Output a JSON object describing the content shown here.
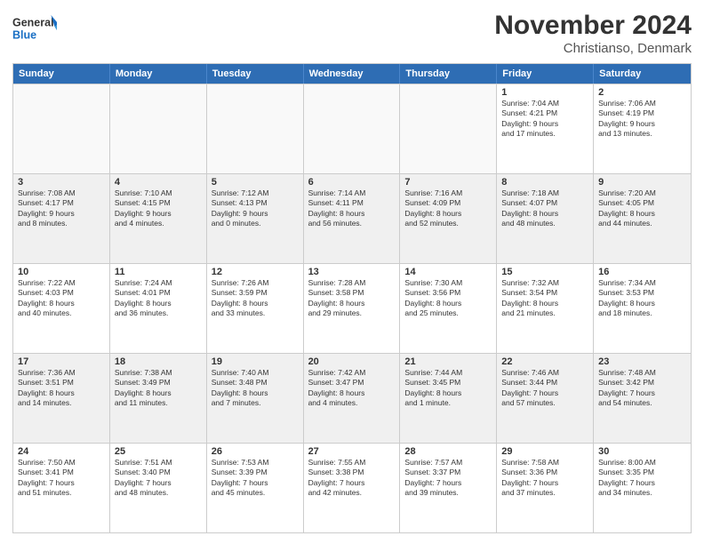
{
  "logo": {
    "text_general": "General",
    "text_blue": "Blue"
  },
  "header": {
    "title": "November 2024",
    "subtitle": "Christianso, Denmark"
  },
  "weekdays": [
    "Sunday",
    "Monday",
    "Tuesday",
    "Wednesday",
    "Thursday",
    "Friday",
    "Saturday"
  ],
  "weeks": [
    [
      {
        "day": "",
        "info": ""
      },
      {
        "day": "",
        "info": ""
      },
      {
        "day": "",
        "info": ""
      },
      {
        "day": "",
        "info": ""
      },
      {
        "day": "",
        "info": ""
      },
      {
        "day": "1",
        "info": "Sunrise: 7:04 AM\nSunset: 4:21 PM\nDaylight: 9 hours\nand 17 minutes."
      },
      {
        "day": "2",
        "info": "Sunrise: 7:06 AM\nSunset: 4:19 PM\nDaylight: 9 hours\nand 13 minutes."
      }
    ],
    [
      {
        "day": "3",
        "info": "Sunrise: 7:08 AM\nSunset: 4:17 PM\nDaylight: 9 hours\nand 8 minutes."
      },
      {
        "day": "4",
        "info": "Sunrise: 7:10 AM\nSunset: 4:15 PM\nDaylight: 9 hours\nand 4 minutes."
      },
      {
        "day": "5",
        "info": "Sunrise: 7:12 AM\nSunset: 4:13 PM\nDaylight: 9 hours\nand 0 minutes."
      },
      {
        "day": "6",
        "info": "Sunrise: 7:14 AM\nSunset: 4:11 PM\nDaylight: 8 hours\nand 56 minutes."
      },
      {
        "day": "7",
        "info": "Sunrise: 7:16 AM\nSunset: 4:09 PM\nDaylight: 8 hours\nand 52 minutes."
      },
      {
        "day": "8",
        "info": "Sunrise: 7:18 AM\nSunset: 4:07 PM\nDaylight: 8 hours\nand 48 minutes."
      },
      {
        "day": "9",
        "info": "Sunrise: 7:20 AM\nSunset: 4:05 PM\nDaylight: 8 hours\nand 44 minutes."
      }
    ],
    [
      {
        "day": "10",
        "info": "Sunrise: 7:22 AM\nSunset: 4:03 PM\nDaylight: 8 hours\nand 40 minutes."
      },
      {
        "day": "11",
        "info": "Sunrise: 7:24 AM\nSunset: 4:01 PM\nDaylight: 8 hours\nand 36 minutes."
      },
      {
        "day": "12",
        "info": "Sunrise: 7:26 AM\nSunset: 3:59 PM\nDaylight: 8 hours\nand 33 minutes."
      },
      {
        "day": "13",
        "info": "Sunrise: 7:28 AM\nSunset: 3:58 PM\nDaylight: 8 hours\nand 29 minutes."
      },
      {
        "day": "14",
        "info": "Sunrise: 7:30 AM\nSunset: 3:56 PM\nDaylight: 8 hours\nand 25 minutes."
      },
      {
        "day": "15",
        "info": "Sunrise: 7:32 AM\nSunset: 3:54 PM\nDaylight: 8 hours\nand 21 minutes."
      },
      {
        "day": "16",
        "info": "Sunrise: 7:34 AM\nSunset: 3:53 PM\nDaylight: 8 hours\nand 18 minutes."
      }
    ],
    [
      {
        "day": "17",
        "info": "Sunrise: 7:36 AM\nSunset: 3:51 PM\nDaylight: 8 hours\nand 14 minutes."
      },
      {
        "day": "18",
        "info": "Sunrise: 7:38 AM\nSunset: 3:49 PM\nDaylight: 8 hours\nand 11 minutes."
      },
      {
        "day": "19",
        "info": "Sunrise: 7:40 AM\nSunset: 3:48 PM\nDaylight: 8 hours\nand 7 minutes."
      },
      {
        "day": "20",
        "info": "Sunrise: 7:42 AM\nSunset: 3:47 PM\nDaylight: 8 hours\nand 4 minutes."
      },
      {
        "day": "21",
        "info": "Sunrise: 7:44 AM\nSunset: 3:45 PM\nDaylight: 8 hours\nand 1 minute."
      },
      {
        "day": "22",
        "info": "Sunrise: 7:46 AM\nSunset: 3:44 PM\nDaylight: 7 hours\nand 57 minutes."
      },
      {
        "day": "23",
        "info": "Sunrise: 7:48 AM\nSunset: 3:42 PM\nDaylight: 7 hours\nand 54 minutes."
      }
    ],
    [
      {
        "day": "24",
        "info": "Sunrise: 7:50 AM\nSunset: 3:41 PM\nDaylight: 7 hours\nand 51 minutes."
      },
      {
        "day": "25",
        "info": "Sunrise: 7:51 AM\nSunset: 3:40 PM\nDaylight: 7 hours\nand 48 minutes."
      },
      {
        "day": "26",
        "info": "Sunrise: 7:53 AM\nSunset: 3:39 PM\nDaylight: 7 hours\nand 45 minutes."
      },
      {
        "day": "27",
        "info": "Sunrise: 7:55 AM\nSunset: 3:38 PM\nDaylight: 7 hours\nand 42 minutes."
      },
      {
        "day": "28",
        "info": "Sunrise: 7:57 AM\nSunset: 3:37 PM\nDaylight: 7 hours\nand 39 minutes."
      },
      {
        "day": "29",
        "info": "Sunrise: 7:58 AM\nSunset: 3:36 PM\nDaylight: 7 hours\nand 37 minutes."
      },
      {
        "day": "30",
        "info": "Sunrise: 8:00 AM\nSunset: 3:35 PM\nDaylight: 7 hours\nand 34 minutes."
      }
    ]
  ]
}
